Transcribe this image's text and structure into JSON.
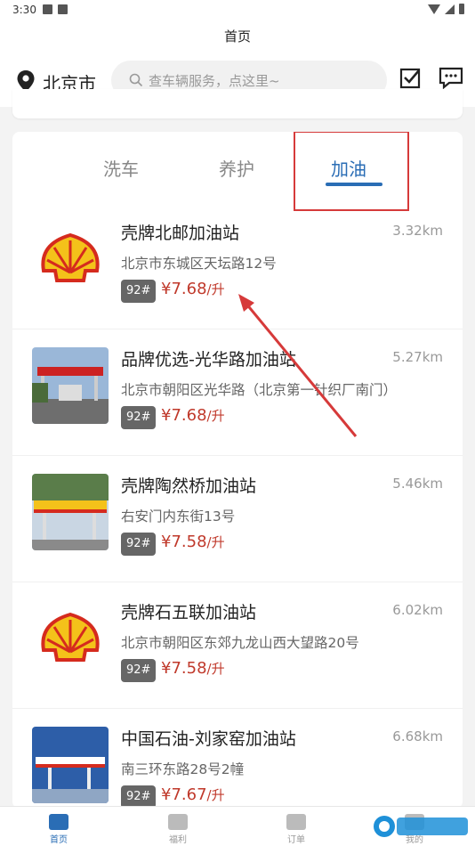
{
  "status_bar": {
    "time": "3:30"
  },
  "header": {
    "title": "首页"
  },
  "location": {
    "city": "北京市"
  },
  "search": {
    "placeholder": "查车辆服务，点这里~"
  },
  "tabs": [
    {
      "label": "洗车",
      "active": false
    },
    {
      "label": "养护",
      "active": false
    },
    {
      "label": "加油",
      "active": true
    }
  ],
  "stations": [
    {
      "name": "壳牌北邮加油站",
      "distance": "3.32km",
      "address": "北京市东城区天坛路12号",
      "fuel": "92#",
      "price": "¥7.68",
      "unit": "/升",
      "thumb": "shell-logo"
    },
    {
      "name": "品牌优选-光华路加油站",
      "distance": "5.27km",
      "address": "北京市朝阳区光华路（北京第一针织厂南门）",
      "fuel": "92#",
      "price": "¥7.68",
      "unit": "/升",
      "thumb": "station-photo"
    },
    {
      "name": "壳牌陶然桥加油站",
      "distance": "5.46km",
      "address": "右安门内东街13号",
      "fuel": "92#",
      "price": "¥7.58",
      "unit": "/升",
      "thumb": "shell-station-photo"
    },
    {
      "name": "壳牌石五联加油站",
      "distance": "6.02km",
      "address": "北京市朝阳区东郊九龙山西大望路20号",
      "fuel": "92#",
      "price": "¥7.58",
      "unit": "/升",
      "thumb": "shell-logo"
    },
    {
      "name": "中国石油-刘家窑加油站",
      "distance": "6.68km",
      "address": "南三环东路28号2幢",
      "fuel": "92#",
      "price": "¥7.67",
      "unit": "/升",
      "thumb": "petrochina-photo"
    }
  ],
  "bottom_nav": [
    {
      "label": "首页",
      "icon": "car-icon",
      "active": true
    },
    {
      "label": "福利",
      "icon": "gift-icon",
      "active": false
    },
    {
      "label": "订单",
      "icon": "order-icon",
      "active": false
    },
    {
      "label": "我的",
      "icon": "user-icon",
      "active": false
    }
  ],
  "colors": {
    "accent": "#2a6db5",
    "price": "#c0392b",
    "highlight_box": "#d63a3a"
  }
}
